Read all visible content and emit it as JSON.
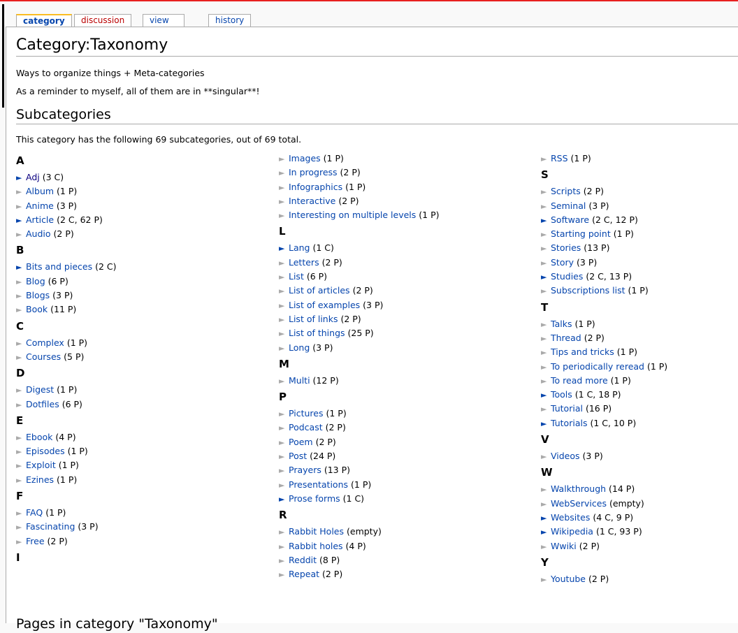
{
  "tabs": {
    "category": "category",
    "discussion": "discussion",
    "view_source": "view source",
    "history": "history"
  },
  "page": {
    "title": "Category:Taxonomy",
    "intro1": "Ways to organize things + Meta-categories",
    "intro2": "As a reminder to myself, all of them are in **singular**!",
    "subcategories_heading": "Subcategories",
    "summary": "This category has the following 69 subcategories, out of 69 total.",
    "pages_heading": "Pages in category \"Taxonomy\""
  },
  "columns": [
    [
      {
        "letter": "A",
        "items": [
          {
            "name": "Adj",
            "count": "(3 C)",
            "expand": true,
            "visited": true
          },
          {
            "name": "Album",
            "count": "(1 P)",
            "expand": false
          },
          {
            "name": "Anime",
            "count": "(3 P)",
            "expand": false
          },
          {
            "name": "Article",
            "count": "(2 C, 62 P)",
            "expand": true
          },
          {
            "name": "Audio",
            "count": "(2 P)",
            "expand": false
          }
        ]
      },
      {
        "letter": "B",
        "items": [
          {
            "name": "Bits and pieces",
            "count": "(2 C)",
            "expand": true
          },
          {
            "name": "Blog",
            "count": "(6 P)",
            "expand": false
          },
          {
            "name": "Blogs",
            "count": "(3 P)",
            "expand": false
          },
          {
            "name": "Book",
            "count": "(11 P)",
            "expand": false
          }
        ]
      },
      {
        "letter": "C",
        "items": [
          {
            "name": "Complex",
            "count": "(1 P)",
            "expand": false
          },
          {
            "name": "Courses",
            "count": "(5 P)",
            "expand": false
          }
        ]
      },
      {
        "letter": "D",
        "items": [
          {
            "name": "Digest",
            "count": "(1 P)",
            "expand": false
          },
          {
            "name": "Dotfiles",
            "count": "(6 P)",
            "expand": false
          }
        ]
      },
      {
        "letter": "E",
        "items": [
          {
            "name": "Ebook",
            "count": "(4 P)",
            "expand": false
          },
          {
            "name": "Episodes",
            "count": "(1 P)",
            "expand": false
          },
          {
            "name": "Exploit",
            "count": "(1 P)",
            "expand": false
          },
          {
            "name": "Ezines",
            "count": "(1 P)",
            "expand": false
          }
        ]
      },
      {
        "letter": "F",
        "items": [
          {
            "name": "FAQ",
            "count": "(1 P)",
            "expand": false
          },
          {
            "name": "Fascinating",
            "count": "(3 P)",
            "expand": false
          },
          {
            "name": "Free",
            "count": "(2 P)",
            "expand": false
          }
        ]
      },
      {
        "letter": "I",
        "items": []
      }
    ],
    [
      {
        "letter": "",
        "items": [
          {
            "name": "Images",
            "count": "(1 P)",
            "expand": false
          },
          {
            "name": "In progress",
            "count": "(2 P)",
            "expand": false
          },
          {
            "name": "Infographics",
            "count": "(1 P)",
            "expand": false
          },
          {
            "name": "Interactive",
            "count": "(2 P)",
            "expand": false
          },
          {
            "name": "Interesting on multiple levels",
            "count": "(1 P)",
            "expand": false
          }
        ]
      },
      {
        "letter": "L",
        "items": [
          {
            "name": "Lang",
            "count": "(1 C)",
            "expand": true
          },
          {
            "name": "Letters",
            "count": "(2 P)",
            "expand": false
          },
          {
            "name": "List",
            "count": "(6 P)",
            "expand": false
          },
          {
            "name": "List of articles",
            "count": "(2 P)",
            "expand": false
          },
          {
            "name": "List of examples",
            "count": "(3 P)",
            "expand": false
          },
          {
            "name": "List of links",
            "count": "(2 P)",
            "expand": false
          },
          {
            "name": "List of things",
            "count": "(25 P)",
            "expand": false
          },
          {
            "name": "Long",
            "count": "(3 P)",
            "expand": false
          }
        ]
      },
      {
        "letter": "M",
        "items": [
          {
            "name": "Multi",
            "count": "(12 P)",
            "expand": false
          }
        ]
      },
      {
        "letter": "P",
        "items": [
          {
            "name": "Pictures",
            "count": "(1 P)",
            "expand": false
          },
          {
            "name": "Podcast",
            "count": "(2 P)",
            "expand": false
          },
          {
            "name": "Poem",
            "count": "(2 P)",
            "expand": false
          },
          {
            "name": "Post",
            "count": "(24 P)",
            "expand": false
          },
          {
            "name": "Prayers",
            "count": "(13 P)",
            "expand": false
          },
          {
            "name": "Presentations",
            "count": "(1 P)",
            "expand": false
          },
          {
            "name": "Prose forms",
            "count": "(1 C)",
            "expand": true
          }
        ]
      },
      {
        "letter": "R",
        "items": [
          {
            "name": "Rabbit Holes",
            "count": "(empty)",
            "expand": false
          },
          {
            "name": "Rabbit holes",
            "count": "(4 P)",
            "expand": false
          },
          {
            "name": "Reddit",
            "count": "(8 P)",
            "expand": false
          },
          {
            "name": "Repeat",
            "count": "(2 P)",
            "expand": false
          }
        ]
      }
    ],
    [
      {
        "letter": "",
        "items": [
          {
            "name": "RSS",
            "count": "(1 P)",
            "expand": false
          }
        ]
      },
      {
        "letter": "S",
        "items": [
          {
            "name": "Scripts",
            "count": "(2 P)",
            "expand": false
          },
          {
            "name": "Seminal",
            "count": "(3 P)",
            "expand": false
          },
          {
            "name": "Software",
            "count": "(2 C, 12 P)",
            "expand": true
          },
          {
            "name": "Starting point",
            "count": "(1 P)",
            "expand": false
          },
          {
            "name": "Stories",
            "count": "(13 P)",
            "expand": false
          },
          {
            "name": "Story",
            "count": "(3 P)",
            "expand": false
          },
          {
            "name": "Studies",
            "count": "(2 C, 13 P)",
            "expand": true
          },
          {
            "name": "Subscriptions list",
            "count": "(1 P)",
            "expand": false
          }
        ]
      },
      {
        "letter": "T",
        "items": [
          {
            "name": "Talks",
            "count": "(1 P)",
            "expand": false
          },
          {
            "name": "Thread",
            "count": "(2 P)",
            "expand": false
          },
          {
            "name": "Tips and tricks",
            "count": "(1 P)",
            "expand": false
          },
          {
            "name": "To periodically reread",
            "count": "(1 P)",
            "expand": false
          },
          {
            "name": "To read more",
            "count": "(1 P)",
            "expand": false
          },
          {
            "name": "Tools",
            "count": "(1 C, 18 P)",
            "expand": true
          },
          {
            "name": "Tutorial",
            "count": "(16 P)",
            "expand": false
          },
          {
            "name": "Tutorials",
            "count": "(1 C, 10 P)",
            "expand": true
          }
        ]
      },
      {
        "letter": "V",
        "items": [
          {
            "name": "Videos",
            "count": "(3 P)",
            "expand": false
          }
        ]
      },
      {
        "letter": "W",
        "items": [
          {
            "name": "Walkthrough",
            "count": "(14 P)",
            "expand": false
          },
          {
            "name": "WebServices",
            "count": "(empty)",
            "expand": false
          },
          {
            "name": "Websites",
            "count": "(4 C, 9 P)",
            "expand": true
          },
          {
            "name": "Wikipedia",
            "count": "(1 C, 93 P)",
            "expand": true
          },
          {
            "name": "Wwiki",
            "count": "(2 P)",
            "expand": false
          }
        ]
      },
      {
        "letter": "Y",
        "items": [
          {
            "name": "Youtube",
            "count": "(2 P)",
            "expand": false
          }
        ]
      }
    ]
  ],
  "colors": {
    "link": "#0645ad",
    "visited": "#0b0080",
    "redlink": "#ba0000",
    "tab_accent": "#fabd23",
    "top_bar": "#e8201f"
  },
  "icons": {
    "expand": "expand-arrow-icon",
    "leaf": "leaf-arrow-icon"
  }
}
